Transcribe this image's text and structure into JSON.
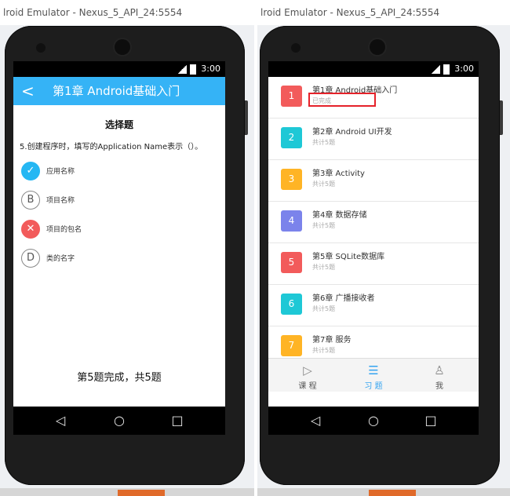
{
  "left": {
    "window_title": "lroid Emulator - Nexus_5_API_24:5554",
    "status_time": "3:00",
    "appbar": {
      "back_icon": "chevron-left-icon",
      "back_glyph": "<",
      "title": "第1章 Android基础入门"
    },
    "question": {
      "type": "选择题",
      "text": "5.创建程序时，填写的Application Name表示（）。",
      "options": [
        {
          "marker": "✓",
          "label": "应用名称",
          "state": "correct"
        },
        {
          "marker": "B",
          "label": "项目名称",
          "state": "normal"
        },
        {
          "marker": "✕",
          "label": "项目的包名",
          "state": "wrong"
        },
        {
          "marker": "D",
          "label": "类的名字",
          "state": "normal"
        }
      ]
    },
    "progress_text": "第5题完成，共5题",
    "nav": {
      "back": "◁",
      "home": "○",
      "recent": "□"
    }
  },
  "right": {
    "window_title": "lroid Emulator - Nexus_5_API_24:5554",
    "status_time": "3:00",
    "chapters": [
      {
        "num": "1",
        "title": "第1章 Android基础入门",
        "sub": "已完成",
        "color": "#f25b5b"
      },
      {
        "num": "2",
        "title": "第2章 Android UI开发",
        "sub": "共计5题",
        "color": "#1ec8d6"
      },
      {
        "num": "3",
        "title": "第3章 Activity",
        "sub": "共计5题",
        "color": "#ffb425"
      },
      {
        "num": "4",
        "title": "第4章 数据存储",
        "sub": "共计5题",
        "color": "#7b83eb"
      },
      {
        "num": "5",
        "title": "第5章 SQLite数据库",
        "sub": "共计5题",
        "color": "#f25b5b"
      },
      {
        "num": "6",
        "title": "第6章 广播接收者",
        "sub": "共计5题",
        "color": "#1ec8d6"
      },
      {
        "num": "7",
        "title": "第7章 服务",
        "sub": "共计5题",
        "color": "#ffb425"
      }
    ],
    "tabs": [
      {
        "label": "课 程",
        "icon": "play-circle-icon",
        "glyph": "▷"
      },
      {
        "label": "习 题",
        "icon": "list-icon",
        "glyph": "☰",
        "active": true
      },
      {
        "label": "我",
        "icon": "person-icon",
        "glyph": "♙"
      }
    ],
    "nav": {
      "back": "◁",
      "home": "○",
      "recent": "□"
    }
  },
  "colors": {
    "accent": "#35b3f6",
    "correct": "#25b7f3",
    "wrong": "#f25b5b",
    "highlight": "#e5222a"
  }
}
